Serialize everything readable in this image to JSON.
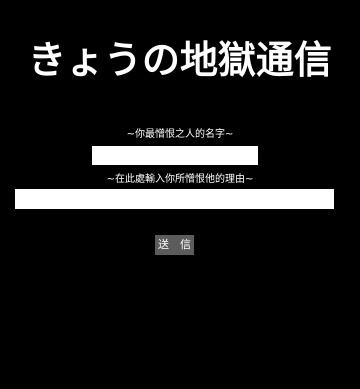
{
  "header": {
    "title": "きょうの地獄通信"
  },
  "form": {
    "name_label": "~你最憎恨之人的名字~",
    "name_value": "",
    "reason_label": "~在此處輸入你所憎恨他的理由~",
    "reason_value": "",
    "submit_label": "送　信"
  },
  "colors": {
    "background": "#000000",
    "text": "#ffffff",
    "field_background": "#ffffff",
    "button_background": "#5c5c5c"
  }
}
